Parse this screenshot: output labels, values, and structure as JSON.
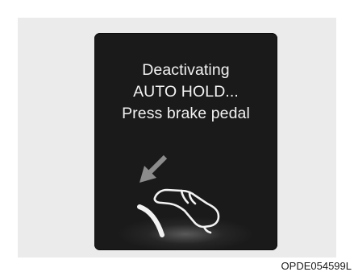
{
  "display": {
    "lines": [
      "Deactivating",
      "AUTO HOLD...",
      "Press brake pedal"
    ]
  },
  "icons": {
    "arrow": "down-left-arrow-icon",
    "pedal": "brake-pedal-foot-icon"
  },
  "colors": {
    "screen": "#1a1a1a",
    "frame": "#ebebeb",
    "text": "#f2f2f2",
    "arrow": "#8c8c8c"
  },
  "figure": {
    "code": "OPDE054599L"
  }
}
